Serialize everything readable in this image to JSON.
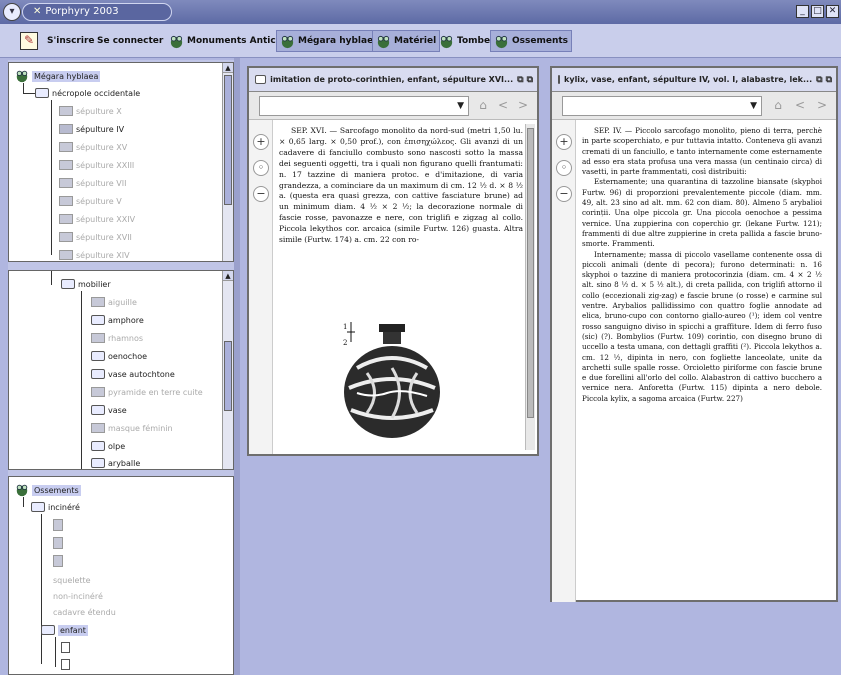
{
  "window": {
    "app_title": "Porphyry 2003"
  },
  "toolbar": {
    "items": [
      {
        "label": "S'inscrire"
      },
      {
        "label": "Se connecter"
      },
      {
        "label": "Monuments Antichi"
      },
      {
        "label": "Mégara hyblaea"
      },
      {
        "label": "Matériel"
      },
      {
        "label": "Tombe"
      },
      {
        "label": "Ossements"
      }
    ]
  },
  "tree1": {
    "root": "Mégara hyblaea",
    "node": "nécropole occidentale",
    "items": [
      "sépulture X",
      "sépulture IV",
      "sépulture XV",
      "sépulture XXIII",
      "sépulture VII",
      "sépulture V",
      "sépulture XXIV",
      "sépulture XVII",
      "sépulture XIV"
    ]
  },
  "tree2": {
    "node": "mobilier",
    "items": [
      "aiguille",
      "amphore",
      "rhamnos",
      "oenochoe",
      "vase autochtone",
      "pyramide en terre cuite",
      "vase",
      "masque féminin",
      "olpe",
      "aryballe"
    ]
  },
  "tree3": {
    "root": "Ossements",
    "node": "incinéré",
    "items": [
      "squelette",
      "non-incinéré",
      "cadavre étendu"
    ],
    "node2": "enfant"
  },
  "doc1": {
    "title": "imitation de proto-corinthien, enfant, sépulture XVI...",
    "text": "SEP. XVI. — Sarcofago monolito da nord-sud (metri 1,50 lu. × 0,65 larg. × 0,50 prof.), con ἐπισηχώλεος. Gli avanzi di un cadavere di fanciullo combusto sono nascosti sotto la massa dei seguenti oggetti, tra i quali non figurano quelli frantumati: n. 17 tazzine di maniera protoc. e d'imitazione, di varia grandezza, a cominciare da un maximum di cm. 12 ½ d. × 8 ½ a. (questa era quasi grezza, con cattive fasciature brune) ad un minimum diam. 4 ½ × 2 ½; la decorazione normale di fascie rosse, pavonazze e nere, con triglifi e zigzag al collo. Piccola lekythos cor. arcaica (simile Furtw. 126) guasta. Altra simile (Furtw. 174) a. cm. 22 con ro-"
  },
  "doc2": {
    "title": "kylix, vase, enfant, sépulture IV, vol. I, alabastre, lek...",
    "text1": "SEP. IV. — Piccolo sarcofago monolito, pieno di terra, perchè in parte scoperchiato, e pur tuttavia intatto. Conteneva gli avanzi cremati di un fanciullo, e tanto internamente come esternamente ad esso era stata profusa una vera massa (un centinaio circa) di vasetti, in parte frammentati, così distribuiti:",
    "text2": "Esternamente; una quarantina di tazzoline biansate (skyphoi Furtw. 96) di proporzioni prevalentemente piccole (diam. mm. 49, alt. 23 sino ad alt. mm. 62 con diam. 80). Almeno 5 arybalioi corinții. Una olpe piccola gr. Una piccola oenochoe a pessima vernice. Una zuppierina con coperchio gr. (lekane Furtw. 121); frammenti di due altre zuppierine in creta pallida a fascie bruno-smorte. Frammenti.",
    "text3": "Internamente; massa di piccolo vasellame contenente ossa di piccoli animali (dente di pecora); furono determinati: n. 16 skyphoi o tazzine di maniera protocorinzia (diam. cm. 4 × 2 ½ alt. sino 8 ½ d. × 5 ½ alt.), di creta pallida, con triglifi attorno il collo (eccezionali zig-zag) e fascie brune (o rosse) e carmine sul ventre. Arybalios pallidissimo con quattro foglie annodate ad elica, bruno-cupo con contorno giallo-aureo (¹); idem col ventre rosso sanguigno diviso in spicchi a graffiture. Idem di ferro fuso (sic) (?). Bombylios (Furtw. 109) corintio, con disegno bruno di uccello a testa umana, con dettagli graffiti (²). Piccola lekythos a. cm. 12 ½, dipinta in nero, con fogliette lanceolate, unite da archetti sulle spalle rosse. Orcioletto piriforme con fascie brune e due forellini all'orlo del collo. Alabastron di cattivo bucchero a vernice nera. Anforetta (Furtw. 115) dipinta a nero debole. Piccola kylix, a sagoma arcaica (Furtw. 227)"
  },
  "colors": {
    "bg": "#b0b6e0",
    "titlebar": "#6b76b1",
    "toolbar": "#c9ceeb",
    "selected": "#c8cdf0"
  },
  "icons": [
    "menu-icon",
    "edit-icon",
    "tree-frog-icon",
    "window-icon",
    "zoom-in-icon",
    "zoom-fit-icon",
    "zoom-out-icon",
    "home-icon",
    "back-icon",
    "forward-icon",
    "vase-illustration"
  ]
}
